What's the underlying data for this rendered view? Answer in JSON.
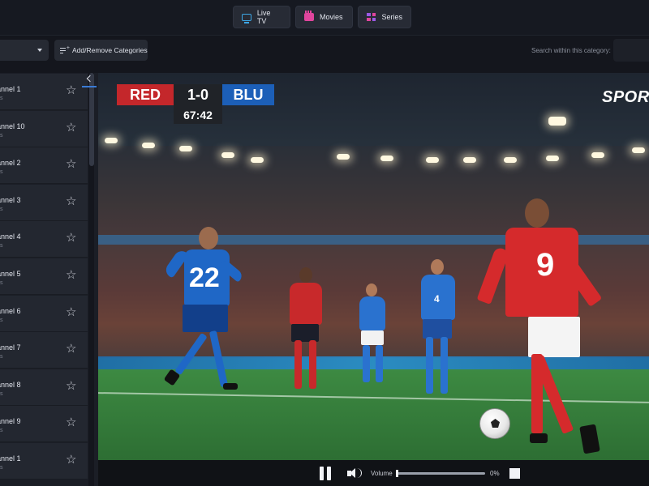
{
  "nav": {
    "tabs": [
      {
        "label": "Live TV",
        "icon": "tv-icon"
      },
      {
        "label": "Movies",
        "icon": "movies-icon"
      },
      {
        "label": "Series",
        "icon": "series-icon"
      }
    ]
  },
  "toolbar": {
    "categories_button": "Add/Remove Categories",
    "search_label": "Search within this category:",
    "search_value": ""
  },
  "sidebar": {
    "channels": [
      {
        "name": "annel 1",
        "sub": "s"
      },
      {
        "name": "annel 10",
        "sub": "s"
      },
      {
        "name": "annel 2",
        "sub": "s"
      },
      {
        "name": "annel 3",
        "sub": "s"
      },
      {
        "name": "annel 4",
        "sub": "s"
      },
      {
        "name": "annel 5",
        "sub": "s"
      },
      {
        "name": "annel 6",
        "sub": "s"
      },
      {
        "name": "annel 7",
        "sub": "s"
      },
      {
        "name": "annel 8",
        "sub": "s"
      },
      {
        "name": "annel 9",
        "sub": "s"
      },
      {
        "name": "annel 1",
        "sub": "s"
      }
    ]
  },
  "video": {
    "scoreboard": {
      "home": "RED",
      "score": "1-0",
      "away": "BLU",
      "clock": "67:42"
    },
    "channel_logo": "SPOR",
    "player_numbers": {
      "blue_forward": "22",
      "red_forward": "9",
      "blue_mid": "4"
    }
  },
  "controls": {
    "volume_label": "Volume",
    "volume_percent": "0%",
    "volume_level": 0
  },
  "colors": {
    "accent_blue": "#3a7bd5",
    "team_red": "#c4272b",
    "team_blue": "#1c5fb8"
  }
}
